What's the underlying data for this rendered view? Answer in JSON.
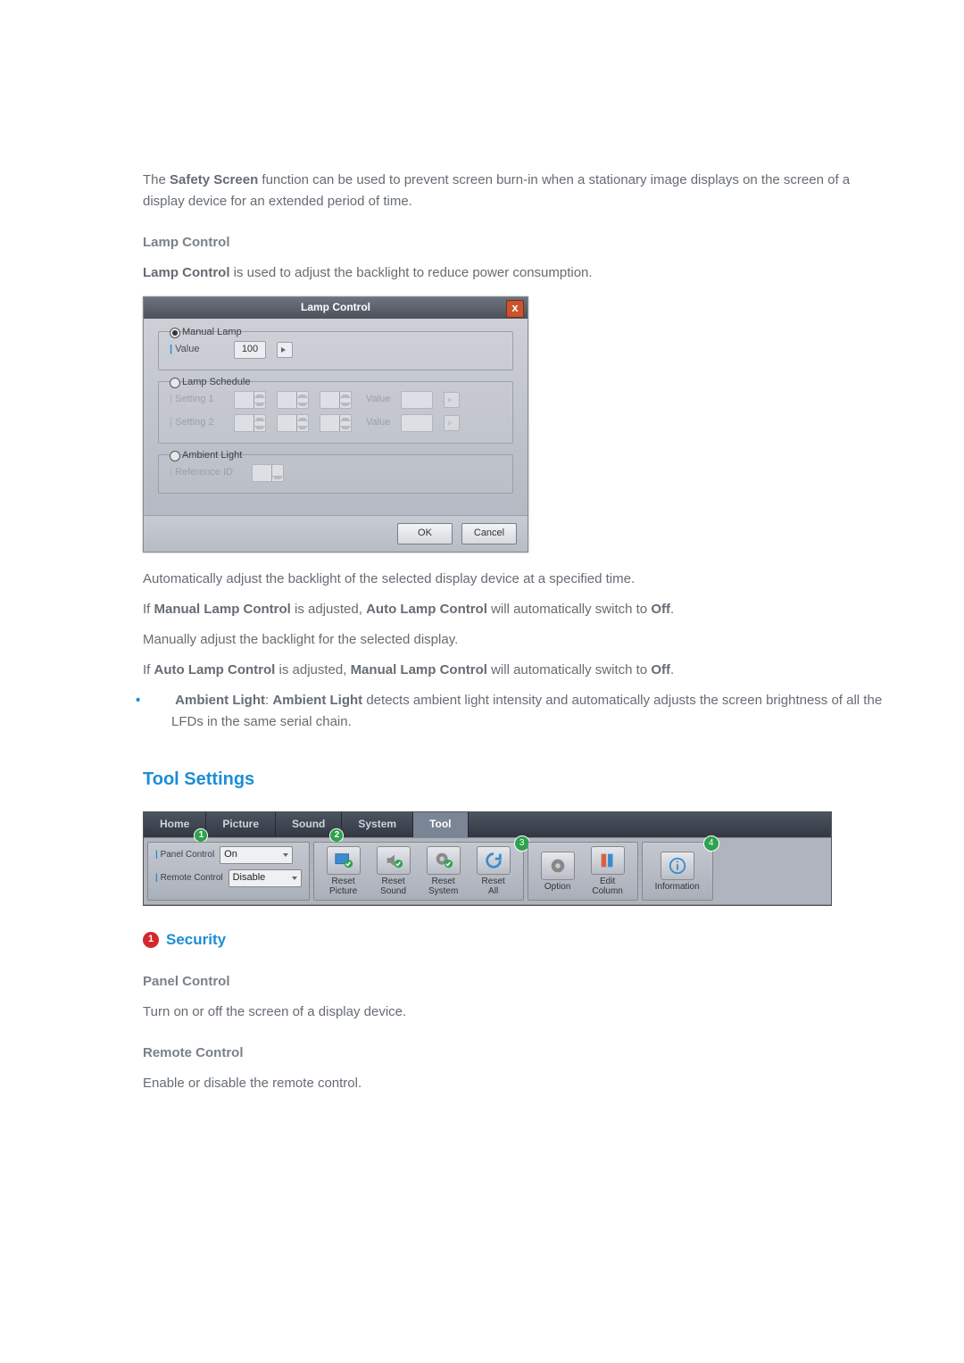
{
  "intro": {
    "safety_para_prefix": "The ",
    "safety_bold": "Safety Screen",
    "safety_para_suffix": " function can be used to prevent screen burn-in when a stationary image displays on the screen of a display device for an extended period of time."
  },
  "lamp": {
    "heading": "Lamp Control",
    "desc_prefix": "",
    "desc_bold": "Lamp Control",
    "desc_suffix": " is used to adjust the backlight to reduce power consumption.",
    "dialog": {
      "title": "Lamp Control",
      "close": "x",
      "manual": {
        "legend": "Manual Lamp",
        "value_label": "Value",
        "value": "100"
      },
      "schedule": {
        "legend": "Lamp Schedule",
        "row1_label": "Setting 1",
        "row2_label": "Setting 2",
        "value_text": "Value"
      },
      "ambient": {
        "legend": "Ambient Light",
        "ref_label": "Reference ID"
      },
      "ok": "OK",
      "cancel": "Cancel"
    },
    "para_auto": "Automatically adjust the backlight of the selected display device at a specified time.",
    "para_mToOff_pre": "If ",
    "para_mToOff_b1": "Manual Lamp Control",
    "para_mToOff_mid": " is adjusted, ",
    "para_mToOff_b2": "Auto Lamp Control",
    "para_mToOff_suf": " will automatically switch to ",
    "para_mToOff_b3": "Off",
    "para_mToOff_end": ".",
    "para_manual": "Manually adjust the backlight for the selected display.",
    "para_aToOff_pre": "If ",
    "para_aToOff_b1": "Auto Lamp Control",
    "para_aToOff_mid": " is adjusted, ",
    "para_aToOff_b2": "Manual Lamp Control",
    "para_aToOff_suf": " will automatically switch to ",
    "para_aToOff_b3": "Off",
    "para_aToOff_end": ".",
    "bullet_b1": "Ambient Light",
    "bullet_sep": ": ",
    "bullet_b2": "Ambient Light",
    "bullet_suffix": " detects ambient light intensity and automatically adjusts the screen brightness of all the LFDs in the same serial chain."
  },
  "tool": {
    "heading": "Tool Settings",
    "tabs": {
      "home": "Home",
      "picture": "Picture",
      "sound": "Sound",
      "system": "System",
      "tool": "Tool"
    },
    "badges": {
      "b1": "1",
      "b2": "2",
      "b3": "3",
      "b4": "4"
    },
    "security": {
      "panel_label": "Panel Control",
      "panel_value": "On",
      "remote_label": "Remote Control",
      "remote_value": "Disable"
    },
    "reset_picture": "Reset\nPicture",
    "reset_sound": "Reset\nSound",
    "reset_system": "Reset\nSystem",
    "reset_all": "Reset\nAll",
    "option": "Option",
    "edit_column": "Edit\nColumn",
    "information": "Information"
  },
  "security": {
    "num": "1",
    "heading": "Security",
    "panel_head": "Panel Control",
    "panel_text": "Turn on or off the screen of a display device.",
    "remote_head": "Remote Control",
    "remote_text": "Enable or disable the remote control."
  }
}
